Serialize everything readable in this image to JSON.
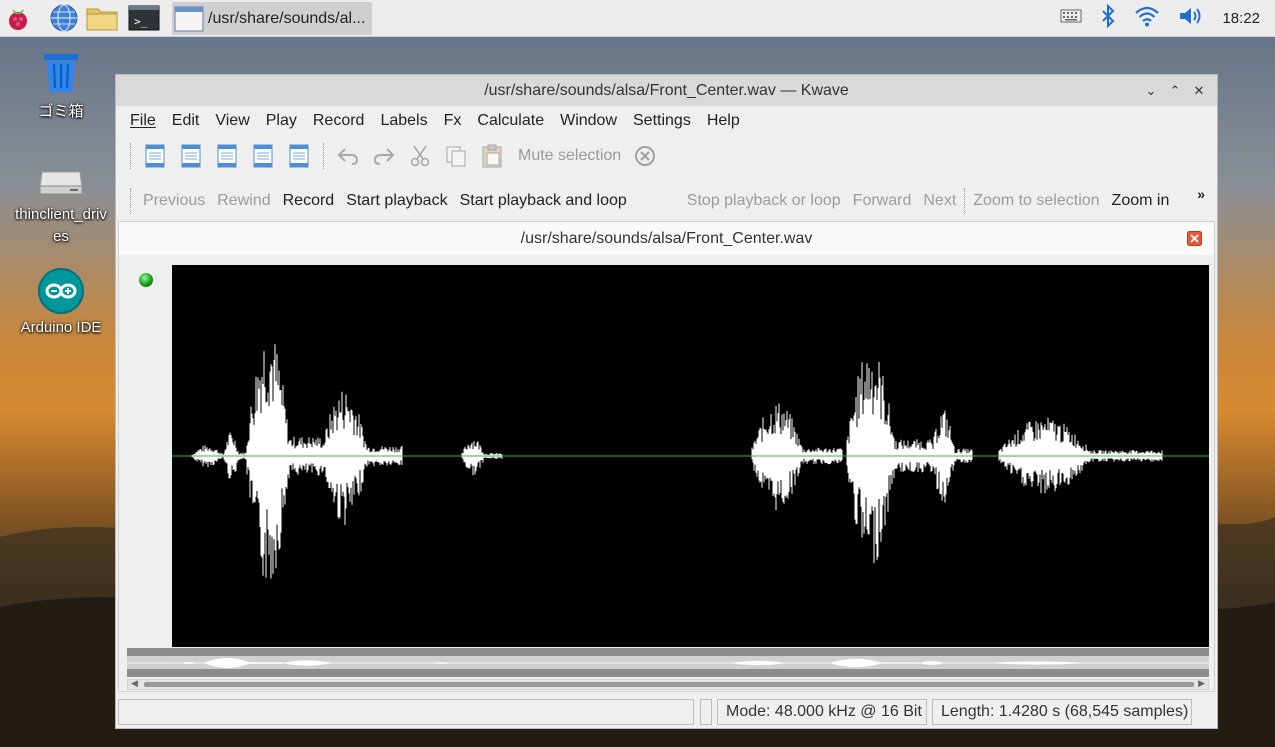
{
  "taskbar": {
    "task_title": "/usr/share/sounds/al...",
    "clock": "18:22",
    "launchers": [
      "raspberry-menu-icon",
      "web-browser-icon",
      "file-manager-icon",
      "terminal-icon"
    ]
  },
  "desktop": {
    "icons": [
      {
        "label": "ゴミ箱",
        "icon": "trash-icon"
      },
      {
        "label": "thinclient_drives",
        "icon": "drive-icon"
      },
      {
        "label": "Arduino IDE",
        "icon": "arduino-icon"
      }
    ]
  },
  "window": {
    "title": "/usr/share/sounds/alsa/Front_Center.wav — Kwave",
    "menu": [
      "File",
      "Edit",
      "View",
      "Play",
      "Record",
      "Labels",
      "Fx",
      "Calculate",
      "Window",
      "Settings",
      "Help"
    ],
    "toolbar1": {
      "mute_selection": "Mute selection"
    },
    "toolbar2": {
      "previous": "Previous",
      "rewind": "Rewind",
      "record": "Record",
      "start_playback": "Start playback",
      "start_playback_loop": "Start playback and loop",
      "stop_playback": "Stop playback or loop",
      "forward": "Forward",
      "next": "Next",
      "zoom_selection": "Zoom to selection",
      "zoom_in": "Zoom in",
      "overflow": "»"
    },
    "document_title": "/usr/share/sounds/alsa/Front_Center.wav",
    "status": {
      "mode": "Mode: 48.000 kHz @ 16 Bit",
      "length": "Length: 1.4280 s (68,545 samples)"
    },
    "colors": {
      "waveform": "#ffffff",
      "zero_line": "#2fbf2f",
      "background": "#000000"
    }
  }
}
